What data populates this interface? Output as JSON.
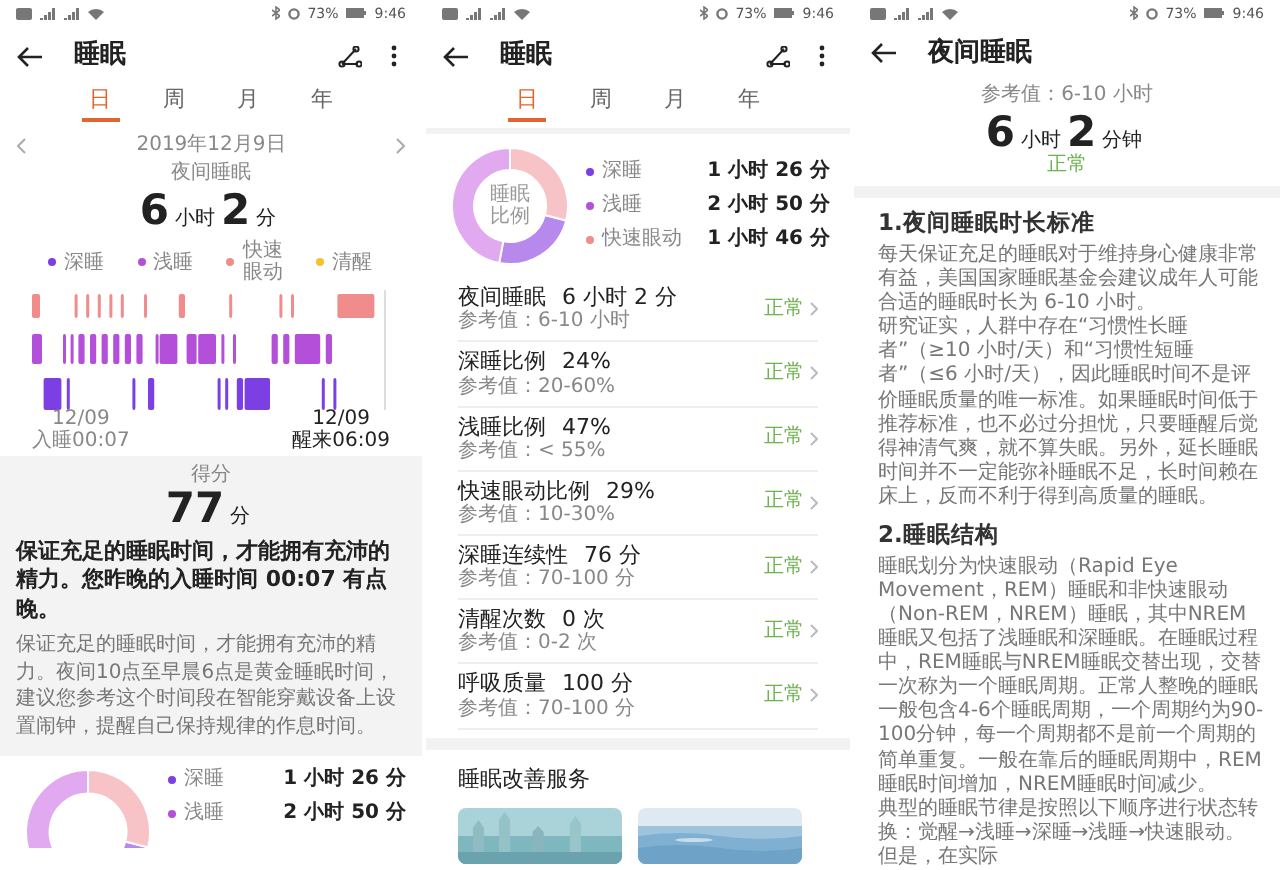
{
  "day_screen": {
    "status_bar": {
      "battery": "73%",
      "time": "9:46"
    },
    "header": {
      "title": "睡眠"
    },
    "tabs": [
      {
        "label": "日",
        "selected": true
      },
      {
        "label": "周",
        "selected": false
      },
      {
        "label": "月",
        "selected": false
      },
      {
        "label": "年",
        "selected": false
      }
    ],
    "date": "2019年12月9日",
    "period_label": "夜间睡眠",
    "duration": {
      "hours": "6",
      "hours_unit": "小时",
      "minutes": "2",
      "minutes_unit": "分"
    },
    "legend": [
      {
        "label": "深睡",
        "color": "#7b3fe4"
      },
      {
        "label": "浅睡",
        "color": "#b44fd9"
      },
      {
        "label": "快速眼动",
        "color": "#f08c8c"
      },
      {
        "label": "清醒",
        "color": "#f2c230"
      }
    ],
    "sleep_start": {
      "date": "12/09",
      "label": "入睡00:07"
    },
    "wake_up": {
      "date": "12/09",
      "label": "醒来06:09"
    },
    "score": {
      "label": "得分",
      "value": "77",
      "unit": "分"
    },
    "advice_title": "保证充足的睡眠时间，才能拥有充沛的精力。您昨晚的入睡时间 00:07 有点晚。",
    "advice_text": "保证充足的睡眠时间，才能拥有充沛的精力。夜间10点至早晨6点是黄金睡眠时间，建议您参考这个时间段在智能穿戴设备上设置闹钟，提醒自己保持规律的作息时间。",
    "breakdown": {
      "items": [
        {
          "label": "深睡",
          "color": "#7b3fe4",
          "value": "1 小时 26 分"
        },
        {
          "label": "浅睡",
          "color": "#b44fd9",
          "value": "2 小时 50 分"
        }
      ]
    }
  },
  "detail_screen": {
    "status_bar": {
      "battery": "73%",
      "time": "9:46"
    },
    "header": {
      "title": "睡眠"
    },
    "tabs": [
      {
        "label": "日",
        "selected": true
      },
      {
        "label": "周",
        "selected": false
      },
      {
        "label": "月",
        "selected": false
      },
      {
        "label": "年",
        "selected": false
      }
    ],
    "breakdown": {
      "center_label": "睡眠比例",
      "chart_data": {
        "type": "donut",
        "categories": [
          "深睡",
          "浅睡",
          "快速眼动"
        ],
        "values": [
          24,
          47,
          29
        ]
      },
      "items": [
        {
          "color": "#7b3fe4",
          "value": "1 小时 26 分"
        },
        {
          "color": "#b44fd9",
          "value": "2 小时 50 分"
        },
        {
          "color": "#f08c8c",
          "value": "1 小时 46 分"
        }
      ]
    },
    "metrics": [
      {
        "name": "夜间睡眠",
        "value": "6 小时 2 分",
        "reference": "参考值：6-10 小时",
        "status": "正常"
      },
      {
        "name": "深睡比例",
        "value": "24%",
        "reference": "参考值：20-60%",
        "status": "正常"
      },
      {
        "name": "浅睡比例",
        "value": "47%",
        "reference": "参考值：< 55%",
        "status": "正常"
      },
      {
        "name": "快速眼动比例",
        "value": "29%",
        "reference": "参考值：10-30%",
        "status": "正常"
      },
      {
        "name": "深睡连续性",
        "value": "76 分",
        "reference": "参考值：70-100 分",
        "status": "正常"
      },
      {
        "name": "清醒次数",
        "value": "0 次",
        "reference": "参考值：0-2 次",
        "status": "正常"
      },
      {
        "name": "呼吸质量",
        "value": "100 分",
        "reference": "参考值：70-100 分",
        "status": "正常"
      }
    ],
    "services": {
      "title": "睡眠改善服务"
    }
  },
  "night_sleep_screen": {
    "status_bar": {
      "battery": "73%",
      "time": "9:46"
    },
    "header": {
      "title": "夜间睡眠"
    },
    "reference": "参考值：6-10 小时",
    "duration": {
      "hours": "6",
      "hours_unit": "小时",
      "minutes": "2",
      "minutes_unit": "分钟"
    },
    "status": "正常",
    "sections": [
      {
        "title": "1.夜间睡眠时长标准",
        "paragraphs": [
          "每天保证充足的睡眠对于维持身心健康非常有益，美国国家睡眠基金会建议成年人可能合适的睡眠时长为 6-10 小时。",
          "研究证实，人群中存在“习惯性长睡者”（≥10 小时/天）和“习惯性短睡者”（≤6 小时/天），因此睡眠时间不是评价睡眠质量的唯一标准。如果睡眠时间低于推荐标准，也不必过分担忧，只要睡醒后觉得神清气爽，就不算失眠。另外，延长睡眠时间并不一定能弥补睡眠不足，长时间赖在床上，反而不利于得到高质量的睡眠。"
        ]
      },
      {
        "title": "2.睡眠结构",
        "paragraphs": [
          "睡眠划分为快速眼动（Rapid Eye Movement，REM）睡眠和非快速眼动（Non-REM，NREM）睡眠，其中NREM睡眠又包括了浅睡眠和深睡眠。在睡眠过程中，REM睡眠与NREM睡眠交替出现，交替一次称为一个睡眠周期。正常人整晚的睡眠一般包含4-6个睡眠周期，一个周期约为90-100分钟，每一个周期都不是前一个周期的简单重复。一般在靠后的睡眠周期中，REM睡眠时间增加，NREM睡眠时间减少。",
          "典型的睡眠节律是按照以下顺序进行状态转换：觉醒→浅睡→深睡→浅睡→快速眼动。但是，在实际"
        ]
      }
    ]
  }
}
